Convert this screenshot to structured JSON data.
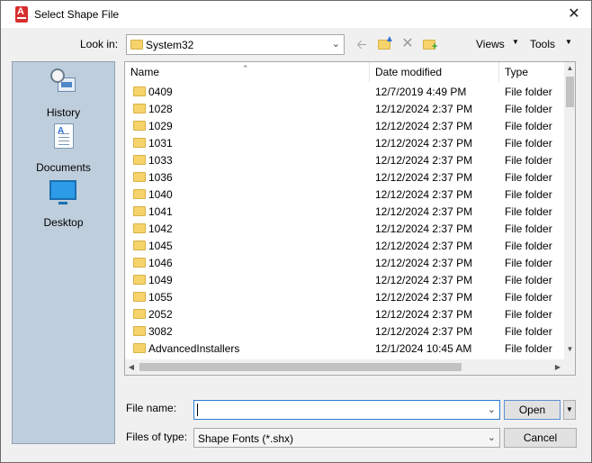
{
  "window": {
    "title": "Select Shape File",
    "close_glyph": "✕"
  },
  "lookin": {
    "label": "Look in:",
    "value": "System32"
  },
  "toolbar": {
    "views_label": "Views",
    "tools_label": "Tools"
  },
  "places": [
    {
      "label": "History",
      "icon": "history-icon"
    },
    {
      "label": "Documents",
      "icon": "documents-icon"
    },
    {
      "label": "Desktop",
      "icon": "desktop-icon"
    }
  ],
  "columns": {
    "name": "Name",
    "date": "Date modified",
    "type": "Type"
  },
  "files": [
    {
      "name": "0409",
      "date": "12/7/2019 4:49 PM",
      "type": "File folder"
    },
    {
      "name": "1028",
      "date": "12/12/2024 2:37 PM",
      "type": "File folder"
    },
    {
      "name": "1029",
      "date": "12/12/2024 2:37 PM",
      "type": "File folder"
    },
    {
      "name": "1031",
      "date": "12/12/2024 2:37 PM",
      "type": "File folder"
    },
    {
      "name": "1033",
      "date": "12/12/2024 2:37 PM",
      "type": "File folder"
    },
    {
      "name": "1036",
      "date": "12/12/2024 2:37 PM",
      "type": "File folder"
    },
    {
      "name": "1040",
      "date": "12/12/2024 2:37 PM",
      "type": "File folder"
    },
    {
      "name": "1041",
      "date": "12/12/2024 2:37 PM",
      "type": "File folder"
    },
    {
      "name": "1042",
      "date": "12/12/2024 2:37 PM",
      "type": "File folder"
    },
    {
      "name": "1045",
      "date": "12/12/2024 2:37 PM",
      "type": "File folder"
    },
    {
      "name": "1046",
      "date": "12/12/2024 2:37 PM",
      "type": "File folder"
    },
    {
      "name": "1049",
      "date": "12/12/2024 2:37 PM",
      "type": "File folder"
    },
    {
      "name": "1055",
      "date": "12/12/2024 2:37 PM",
      "type": "File folder"
    },
    {
      "name": "2052",
      "date": "12/12/2024 2:37 PM",
      "type": "File folder"
    },
    {
      "name": "3082",
      "date": "12/12/2024 2:37 PM",
      "type": "File folder"
    },
    {
      "name": "AdvancedInstallers",
      "date": "12/1/2024 10:45 AM",
      "type": "File folder"
    }
  ],
  "filename": {
    "label": "File name:",
    "value": ""
  },
  "filetype": {
    "label": "Files of type:",
    "value": "Shape Fonts (*.shx)"
  },
  "buttons": {
    "open": "Open",
    "cancel": "Cancel"
  },
  "colors": {
    "places_bg": "#bfcedc",
    "folder": "#f6d36b",
    "focus_border": "#2a7bd6",
    "app_icon": "#d62d2d"
  }
}
